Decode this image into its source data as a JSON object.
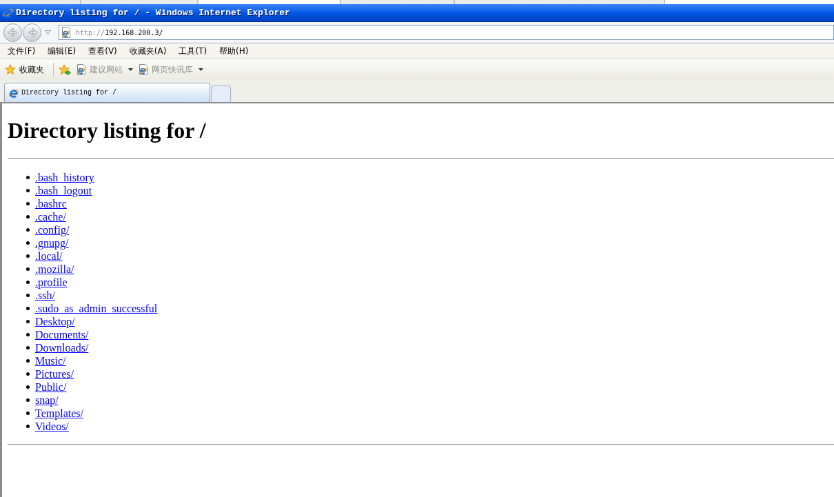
{
  "window": {
    "title": "Directory listing for / - Windows Internet Explorer"
  },
  "address_bar": {
    "scheme": "http://",
    "host": "192.168.200.3/"
  },
  "menu_bar": [
    "文件(F)",
    "编辑(E)",
    "查看(V)",
    "收藏夹(A)",
    "工具(T)",
    "帮助(H)"
  ],
  "favorites_bar": {
    "favorites_label": "收藏夹",
    "links": [
      "建议网站",
      "网页快讯库"
    ]
  },
  "tabs": [
    {
      "label": "Directory listing for /",
      "selected": true
    }
  ],
  "page": {
    "heading": "Directory listing for /",
    "entries": [
      ".bash_history",
      ".bash_logout",
      ".bashrc",
      ".cache/",
      ".config/",
      ".gnupg/",
      ".local/",
      ".mozilla/",
      ".profile",
      ".ssh/",
      ".sudo_as_admin_successful",
      "Desktop/",
      "Documents/",
      "Downloads/",
      "Music/",
      "Pictures/",
      "Public/",
      "snap/",
      "Templates/",
      "Videos/"
    ]
  }
}
